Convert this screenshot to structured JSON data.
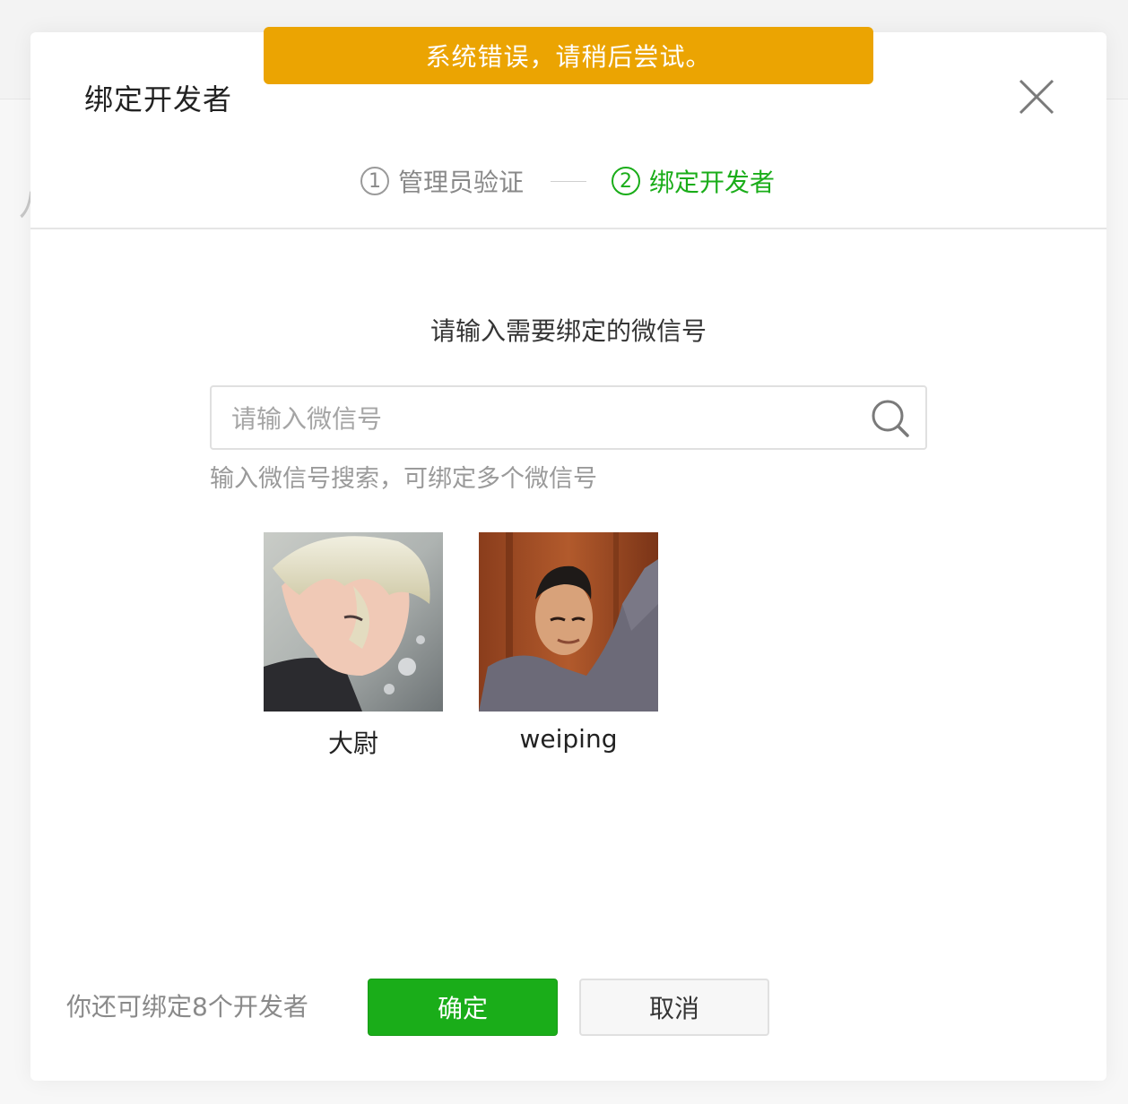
{
  "toast": {
    "message": "系统错误，请稍后尝试。",
    "color": "#eba402"
  },
  "dialog": {
    "title": "绑定开发者",
    "steps": [
      {
        "number": "1",
        "label": "管理员验证",
        "state": "done"
      },
      {
        "number": "2",
        "label": "绑定开发者",
        "state": "active"
      }
    ],
    "prompt": "请输入需要绑定的微信号",
    "search": {
      "value": "",
      "placeholder": "请输入微信号",
      "icon": "search-icon"
    },
    "helper": "输入微信号搜索，可绑定多个微信号",
    "users": [
      {
        "name": "大尉",
        "avatar": "anime-character-avatar"
      },
      {
        "name": "weiping",
        "avatar": "man-photo-avatar"
      }
    ],
    "remaining": "你还可绑定8个开发者",
    "buttons": {
      "confirm": "确定",
      "cancel": "取消"
    }
  },
  "colors": {
    "accent": "#1aad19",
    "warning": "#eba402"
  }
}
